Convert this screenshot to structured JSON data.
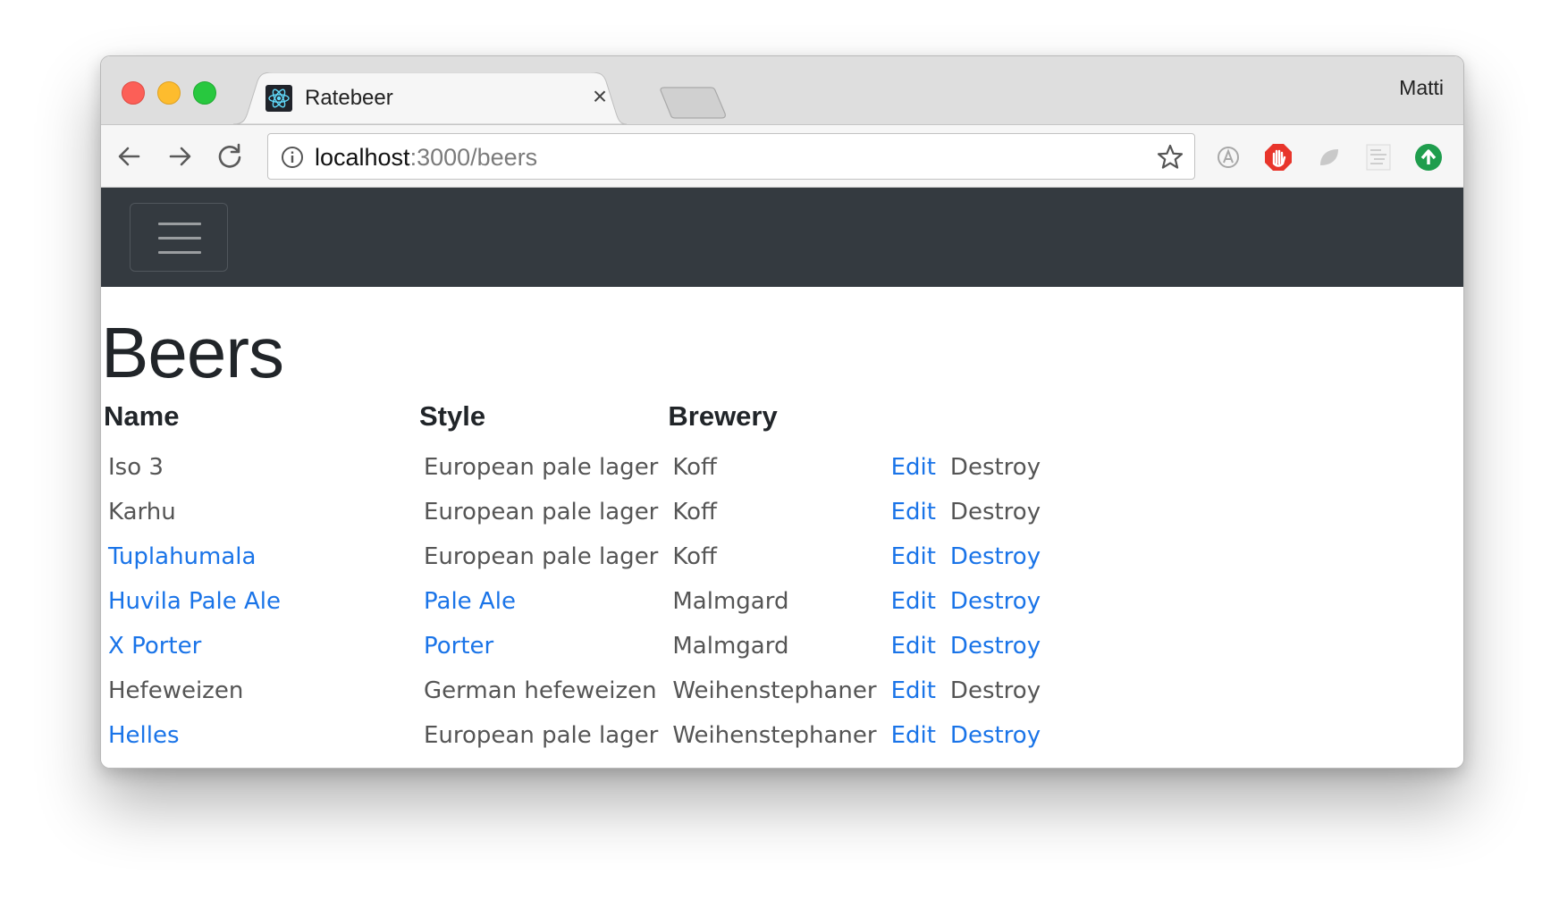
{
  "browser": {
    "tab": {
      "title": "Ratebeer",
      "favicon": "react-atom-icon",
      "close": "×"
    },
    "profile_name": "Matti",
    "url": {
      "host": "localhost",
      "rest": ":3000/beers"
    },
    "extensions": [
      "a-circle-icon",
      "adblock-hand-icon",
      "leaf-icon",
      "notepad-icon",
      "green-upload-icon"
    ]
  },
  "navbar": {
    "toggler_icon": "hamburger-icon",
    "background": "#343a40"
  },
  "page": {
    "title": "Beers",
    "table": {
      "headers": {
        "name": "Name",
        "style": "Style",
        "brewery": "Brewery"
      },
      "rows": [
        {
          "name": "Iso 3",
          "name_link": false,
          "style": "European pale lager",
          "style_link": false,
          "brewery": "Koff",
          "edit": "Edit",
          "destroy": "Destroy",
          "destroy_link": false
        },
        {
          "name": "Karhu",
          "name_link": false,
          "style": "European pale lager",
          "style_link": false,
          "brewery": "Koff",
          "edit": "Edit",
          "destroy": "Destroy",
          "destroy_link": false
        },
        {
          "name": "Tuplahumala",
          "name_link": true,
          "style": "European pale lager",
          "style_link": false,
          "brewery": "Koff",
          "edit": "Edit",
          "destroy": "Destroy",
          "destroy_link": true
        },
        {
          "name": "Huvila Pale Ale",
          "name_link": true,
          "style": "Pale Ale",
          "style_link": true,
          "brewery": "Malmgard",
          "edit": "Edit",
          "destroy": "Destroy",
          "destroy_link": true
        },
        {
          "name": "X Porter",
          "name_link": true,
          "style": "Porter",
          "style_link": true,
          "brewery": "Malmgard",
          "edit": "Edit",
          "destroy": "Destroy",
          "destroy_link": true
        },
        {
          "name": "Hefeweizen",
          "name_link": false,
          "style": "German hefeweizen",
          "style_link": false,
          "brewery": "Weihenstephaner",
          "edit": "Edit",
          "destroy": "Destroy",
          "destroy_link": false
        },
        {
          "name": "Helles",
          "name_link": true,
          "style": "European pale lager",
          "style_link": false,
          "brewery": "Weihenstephaner",
          "edit": "Edit",
          "destroy": "Destroy",
          "destroy_link": true
        }
      ]
    }
  },
  "colors": {
    "link": "#1a74e8",
    "text": "#555555",
    "heading": "#212529"
  }
}
